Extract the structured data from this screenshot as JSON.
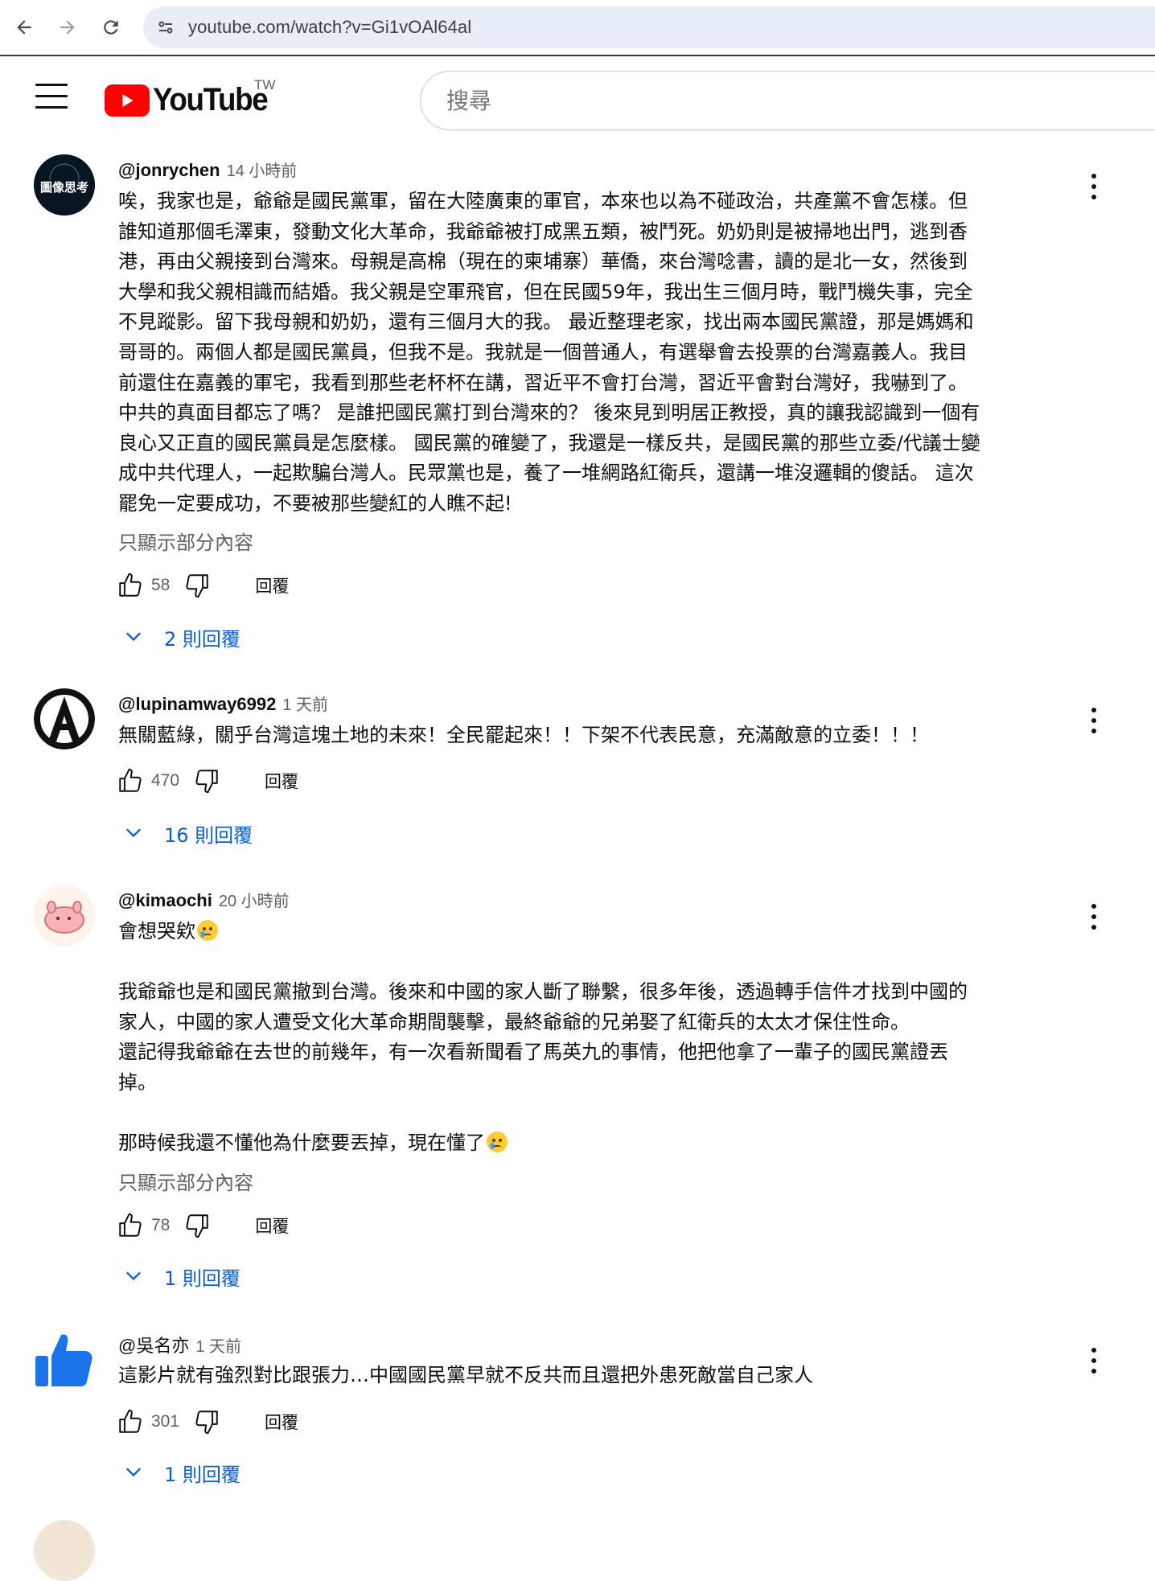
{
  "browser": {
    "url": "youtube.com/watch?v=Gi1vOAl64al"
  },
  "masthead": {
    "logo_text": "YouTube",
    "region": "TW",
    "search_placeholder": "搜尋"
  },
  "comments": [
    {
      "author": "@jonrychen",
      "time": "14 小時前",
      "avatar_text": "圖像思考",
      "lines": [
        "唉，我家也是，爺爺是國民黨軍，留在大陸廣東的軍官，本來也以為不碰政治，共產黨不會怎樣。但",
        "誰知道那個毛澤東，發動文化大革命，我爺爺被打成黑五類，被鬥死。奶奶則是被掃地出門，逃到香",
        "港，再由父親接到台灣來。母親是高棉（現在的柬埔寨）華僑，來台灣唸書，讀的是北一女，然後到",
        "大學和我父親相識而結婚。我父親是空軍飛官，但在民國59年，我出生三個月時，戰鬥機失事，完全",
        "不見蹤影。留下我母親和奶奶，還有三個月大的我。 最近整理老家，找出兩本國民黨證，那是媽媽和",
        "哥哥的。兩個人都是國民黨員，但我不是。我就是一個普通人，有選舉會去投票的台灣嘉義人。我目",
        "前還住在嘉義的軍宅，我看到那些老杯杯在講，習近平不會打台灣，習近平會對台灣好，我嚇到了。",
        "中共的真面目都忘了嗎？ 是誰把國民黨打到台灣來的？ 後來見到明居正教授，真的讓我認識到一個有",
        "良心又正直的國民黨員是怎麼樣。 國民黨的確變了，我還是一樣反共，是國民黨的那些立委/代議士變",
        "成中共代理人，一起欺騙台灣人。民眾黨也是，養了一堆網路紅衛兵，還講一堆沒邏輯的傻話。 這次",
        "罷免一定要成功，不要被那些變紅的人瞧不起!"
      ],
      "read_more": "只顯示部分內容",
      "likes": "58",
      "reply_label": "回覆",
      "replies": "2 則回覆"
    },
    {
      "author": "@lupinamway6992",
      "time": "1 天前",
      "lines": [
        "無關藍綠，關乎台灣這塊土地的未來！全民罷起來！！下架不代表民意，充滿敵意的立委！！！"
      ],
      "likes": "470",
      "reply_label": "回覆",
      "replies": "16 則回覆"
    },
    {
      "author": "@kimaochi",
      "time": "20 小時前",
      "line_first": "會想哭欸",
      "lines": [
        "",
        "我爺爺也是和國民黨撤到台灣。後來和中國的家人斷了聯繫，很多年後，透過轉手信件才找到中國的",
        "家人，中國的家人遭受文化大革命期間襲擊，最終爺爺的兄弟娶了紅衛兵的太太才保住性命。",
        "還記得我爺爺在去世的前幾年，有一次看新聞看了馬英九的事情，他把他拿了一輩子的國民黨證丟",
        "掉。",
        ""
      ],
      "line_last": "那時候我還不懂他為什麼要丟掉，現在懂了",
      "read_more": "只顯示部分內容",
      "likes": "78",
      "reply_label": "回覆",
      "replies": "1 則回覆"
    },
    {
      "author": "@吳名亦",
      "time": "1 天前",
      "lines": [
        "這影片就有強烈對比跟張力…中國國民黨早就不反共而且還把外患死敵當自己家人"
      ],
      "likes": "301",
      "reply_label": "回覆",
      "replies": "1 則回覆"
    }
  ]
}
